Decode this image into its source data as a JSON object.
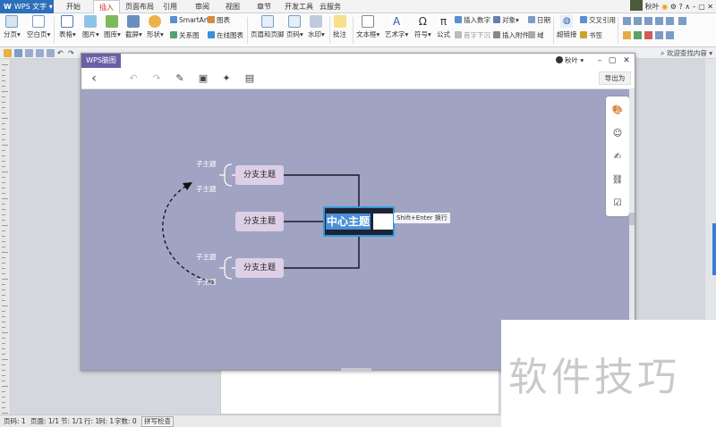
{
  "app": {
    "logo_letter": "W",
    "name": "WPS 文字"
  },
  "menu": {
    "tabs": [
      "开始",
      "插入",
      "页面布局",
      "引用",
      "审阅",
      "视图",
      "章节",
      "开发工具",
      "云服务"
    ],
    "active_index": 1
  },
  "top_user": {
    "name": "秋叶"
  },
  "ribbon": {
    "page_break": "分页",
    "blank_page": "空白页",
    "table": "表格",
    "picture": "图片",
    "library": "图库",
    "screenshot": "截屏",
    "shape": "形状",
    "smartart": "SmartArt",
    "chart": "图表",
    "relation": "关系图",
    "online_chart": "在线图表",
    "header_footer": "页眉和页脚",
    "page_number": "页码",
    "watermark": "水印",
    "comment": "批注",
    "textbox": "文本框",
    "wordart": "艺术字",
    "symbol": "符号",
    "formula": "公式",
    "insert_number": "插入数字",
    "object": "对象",
    "date": "日期",
    "first_char": "首字下沉",
    "attachment": "插入附件",
    "field": "域",
    "hyperlink": "超链接",
    "crossref": "交叉引用",
    "bookmark": "书签"
  },
  "quickbar": {
    "doc_title": "欢迎查找内容"
  },
  "status": {
    "page": "页码: 1",
    "pages": "页面: 1/1",
    "section": "节: 1/1",
    "row": "行: 1",
    "col": "列: 1",
    "words": "字数: 0",
    "spell": "拼写检查"
  },
  "mindmap": {
    "app_tab": "WPS脑图",
    "user": "秋叶",
    "export": "导出为",
    "central": "中心主题",
    "hint": "Shift+Enter 换行",
    "branches": [
      "分支主题",
      "分支主题",
      "分支主题"
    ],
    "subtopic": "子主题",
    "subtopic_count": 4
  },
  "colors": {
    "canvas": "#a1a3c3",
    "branch": "#dccfe6",
    "central_bg": "#1e2333",
    "central_border": "#2f9bd8",
    "mm_tab": "#6c5fa8"
  },
  "watermark_text": "软件技巧"
}
